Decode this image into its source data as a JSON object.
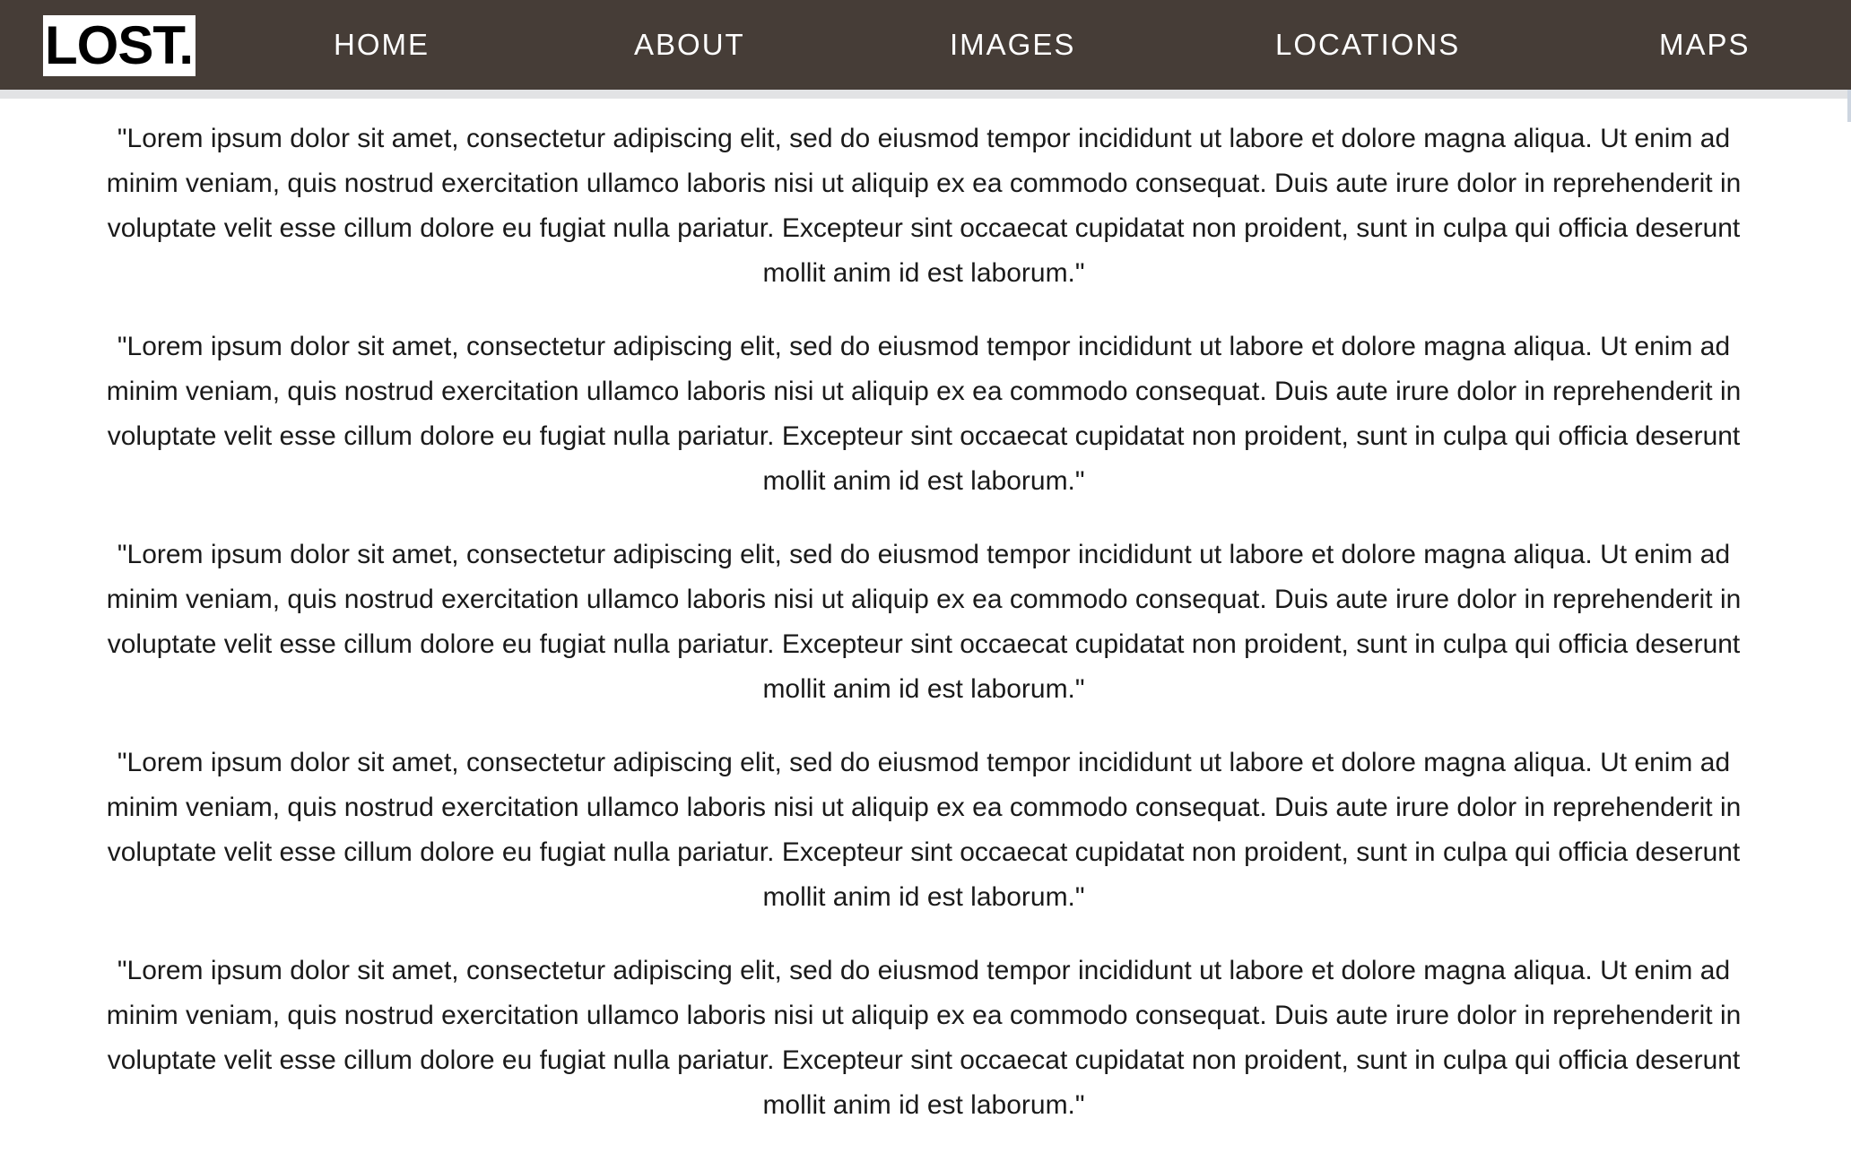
{
  "navbar": {
    "logo": "LOST.",
    "links": [
      "HOME",
      "ABOUT",
      "IMAGES",
      "LOCATIONS",
      "MAPS"
    ],
    "background_color": "#463d37"
  },
  "content": {
    "paragraphs": [
      "\"Lorem ipsum dolor sit amet, consectetur adipiscing elit, sed do eiusmod tempor incididunt ut labore et dolore magna aliqua. Ut enim ad minim veniam, quis nostrud exercitation ullamco laboris nisi ut aliquip ex ea commodo consequat. Duis aute irure dolor in reprehenderit in voluptate velit esse cillum dolore eu fugiat nulla pariatur. Excepteur sint occaecat cupidatat non proident, sunt in culpa qui officia deserunt mollit anim id est laborum.\"",
      "\"Lorem ipsum dolor sit amet, consectetur adipiscing elit, sed do eiusmod tempor incididunt ut labore et dolore magna aliqua. Ut enim ad minim veniam, quis nostrud exercitation ullamco laboris nisi ut aliquip ex ea commodo consequat. Duis aute irure dolor in reprehenderit in voluptate velit esse cillum dolore eu fugiat nulla pariatur. Excepteur sint occaecat cupidatat non proident, sunt in culpa qui officia deserunt mollit anim id est laborum.\"",
      "\"Lorem ipsum dolor sit amet, consectetur adipiscing elit, sed do eiusmod tempor incididunt ut labore et dolore magna aliqua. Ut enim ad minim veniam, quis nostrud exercitation ullamco laboris nisi ut aliquip ex ea commodo consequat. Duis aute irure dolor in reprehenderit in voluptate velit esse cillum dolore eu fugiat nulla pariatur. Excepteur sint occaecat cupidatat non proident, sunt in culpa qui officia deserunt mollit anim id est laborum.\"",
      "\"Lorem ipsum dolor sit amet, consectetur adipiscing elit, sed do eiusmod tempor incididunt ut labore et dolore magna aliqua. Ut enim ad minim veniam, quis nostrud exercitation ullamco laboris nisi ut aliquip ex ea commodo consequat. Duis aute irure dolor in reprehenderit in voluptate velit esse cillum dolore eu fugiat nulla pariatur. Excepteur sint occaecat cupidatat non proident, sunt in culpa qui officia deserunt mollit anim id est laborum.\"",
      "\"Lorem ipsum dolor sit amet, consectetur adipiscing elit, sed do eiusmod tempor incididunt ut labore et dolore magna aliqua. Ut enim ad minim veniam, quis nostrud exercitation ullamco laboris nisi ut aliquip ex ea commodo consequat. Duis aute irure dolor in reprehenderit in voluptate velit esse cillum dolore eu fugiat nulla pariatur. Excepteur sint occaecat cupidatat non proident, sunt in culpa qui officia deserunt mollit anim id est laborum.\""
    ]
  }
}
